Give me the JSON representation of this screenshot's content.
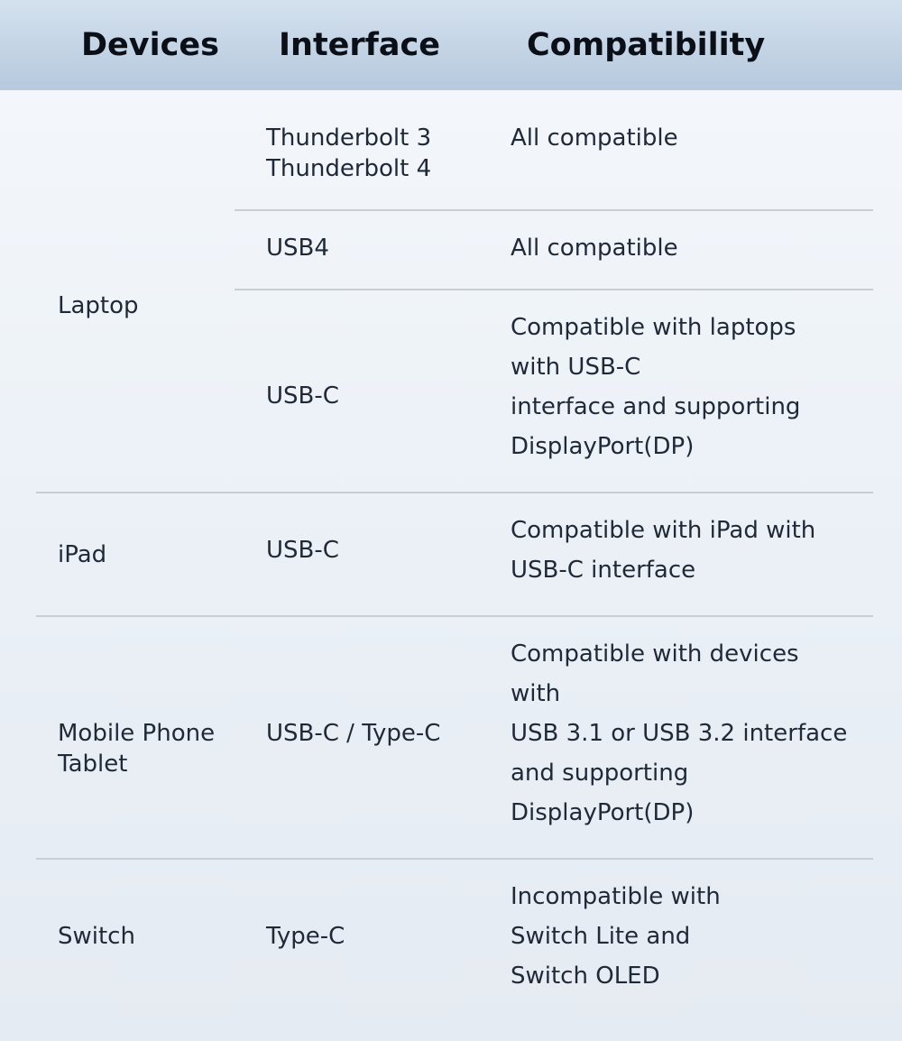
{
  "header": {
    "devices": "Devices",
    "interface": "Interface",
    "compatibility": "Compatibility"
  },
  "rows": {
    "laptop": {
      "device": "Laptop",
      "thunderbolt": {
        "interface_line1": "Thunderbolt 3",
        "interface_line2": "Thunderbolt 4",
        "compat": "All compatible"
      },
      "usb4": {
        "interface": "USB4",
        "compat": "All compatible"
      },
      "usbc": {
        "interface": "USB-C",
        "compat_line1": "Compatible with laptops",
        "compat_line2": "with USB-C",
        "compat_line3": "interface and supporting",
        "compat_line4": "DisplayPort(DP)"
      }
    },
    "ipad": {
      "device": "iPad",
      "interface": "USB-C",
      "compat_line1": "Compatible with iPad with",
      "compat_line2": "USB-C interface"
    },
    "mobile": {
      "device_line1": "Mobile Phone",
      "device_line2": "Tablet",
      "interface": "USB-C / Type-C",
      "compat_line1": "Compatible with devices",
      "compat_line2": "with",
      "compat_line3": "USB 3.1 or USB 3.2 interface",
      "compat_line4": "and supporting",
      "compat_line5": "DisplayPort(DP)"
    },
    "switch": {
      "device": "Switch",
      "interface": "Type-C",
      "compat_line1": "Incompatible with",
      "compat_line2": "Switch Lite and",
      "compat_line3": "Switch OLED"
    }
  }
}
